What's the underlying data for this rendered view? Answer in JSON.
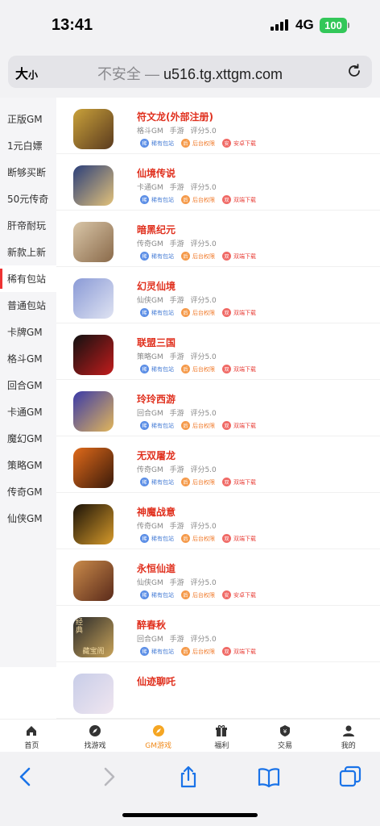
{
  "status": {
    "time": "13:41",
    "network": "4G",
    "battery": "100"
  },
  "browser": {
    "text_size_label": "大",
    "text_size_small": "小",
    "insecure_label": "不安全 —",
    "domain": "u516.tg.xttgm.com"
  },
  "sidebar": {
    "active_index": 6,
    "items": [
      {
        "label": "正版GM"
      },
      {
        "label": "1元白嫖"
      },
      {
        "label": "断够买断"
      },
      {
        "label": "50元传奇"
      },
      {
        "label": "肝帝耐玩"
      },
      {
        "label": "新款上新"
      },
      {
        "label": "稀有包站"
      },
      {
        "label": "普通包站"
      },
      {
        "label": "卡牌GM"
      },
      {
        "label": "格斗GM"
      },
      {
        "label": "回合GM"
      },
      {
        "label": "卡通GM"
      },
      {
        "label": "魔幻GM"
      },
      {
        "label": "策略GM"
      },
      {
        "label": "传奇GM"
      },
      {
        "label": "仙侠GM"
      }
    ]
  },
  "games": [
    {
      "title": "符文龙(外部注册)",
      "meta": "格斗GM 手游 评分5.0",
      "tags": [
        {
          "icon": "稀",
          "label": "稀有包站",
          "color": "blue"
        },
        {
          "icon": "后",
          "label": "后台权限",
          "color": "orange"
        },
        {
          "icon": "安",
          "label": "安卓下载",
          "color": "red"
        }
      ],
      "icon_colors": [
        "#c9a13a",
        "#5a3a1e"
      ]
    },
    {
      "title": "仙境传说",
      "meta": "卡通GM 手游 评分5.0",
      "tags": [
        {
          "icon": "稀",
          "label": "稀有包站",
          "color": "blue"
        },
        {
          "icon": "后",
          "label": "后台权限",
          "color": "orange"
        },
        {
          "icon": "双",
          "label": "双端下载",
          "color": "red"
        }
      ],
      "icon_colors": [
        "#2b3f7a",
        "#e3c27a"
      ]
    },
    {
      "title": "暗黑纪元",
      "meta": "传奇GM 手游 评分5.0",
      "tags": [
        {
          "icon": "稀",
          "label": "稀有包站",
          "color": "blue"
        },
        {
          "icon": "后",
          "label": "后台权限",
          "color": "orange"
        },
        {
          "icon": "双",
          "label": "双端下载",
          "color": "red"
        }
      ],
      "icon_colors": [
        "#d9c6a8",
        "#8a6a4a"
      ]
    },
    {
      "title": "幻灵仙境",
      "meta": "仙侠GM 手游 评分5.0",
      "tags": [
        {
          "icon": "稀",
          "label": "稀有包站",
          "color": "blue"
        },
        {
          "icon": "后",
          "label": "后台权限",
          "color": "orange"
        },
        {
          "icon": "双",
          "label": "双端下载",
          "color": "red"
        }
      ],
      "icon_colors": [
        "#8a9ad6",
        "#dfe3f2"
      ]
    },
    {
      "title": "联盟三国",
      "meta": "策略GM 手游 评分5.0",
      "tags": [
        {
          "icon": "稀",
          "label": "稀有包站",
          "color": "blue"
        },
        {
          "icon": "后",
          "label": "后台权限",
          "color": "orange"
        },
        {
          "icon": "双",
          "label": "双端下载",
          "color": "red"
        }
      ],
      "icon_colors": [
        "#111111",
        "#c21c1c"
      ]
    },
    {
      "title": "玲玲西游",
      "meta": "回合GM 手游 评分5.0",
      "tags": [
        {
          "icon": "稀",
          "label": "稀有包站",
          "color": "blue"
        },
        {
          "icon": "后",
          "label": "后台权限",
          "color": "orange"
        },
        {
          "icon": "双",
          "label": "双端下载",
          "color": "red"
        }
      ],
      "icon_colors": [
        "#3a3aa8",
        "#e2b65a"
      ]
    },
    {
      "title": "无双屠龙",
      "meta": "传奇GM 手游 评分5.0",
      "tags": [
        {
          "icon": "稀",
          "label": "稀有包站",
          "color": "blue"
        },
        {
          "icon": "后",
          "label": "后台权限",
          "color": "orange"
        },
        {
          "icon": "双",
          "label": "双端下载",
          "color": "red"
        }
      ],
      "icon_colors": [
        "#e06a1a",
        "#3a1a0a"
      ]
    },
    {
      "title": "神魔战意",
      "meta": "传奇GM 手游 评分5.0",
      "tags": [
        {
          "icon": "稀",
          "label": "稀有包站",
          "color": "blue"
        },
        {
          "icon": "后",
          "label": "后台权限",
          "color": "orange"
        },
        {
          "icon": "双",
          "label": "双端下载",
          "color": "red"
        }
      ],
      "icon_colors": [
        "#1a1208",
        "#d69a2a"
      ]
    },
    {
      "title": "永恒仙道",
      "meta": "仙侠GM 手游 评分5.0",
      "tags": [
        {
          "icon": "稀",
          "label": "稀有包站",
          "color": "blue"
        },
        {
          "icon": "后",
          "label": "后台权限",
          "color": "orange"
        },
        {
          "icon": "安",
          "label": "安卓下载",
          "color": "red"
        }
      ],
      "icon_colors": [
        "#c98a4a",
        "#5a2a1a"
      ]
    },
    {
      "title": "醉春秋",
      "meta": "回合GM 手游 评分5.0",
      "tags": [
        {
          "icon": "稀",
          "label": "稀有包站",
          "color": "blue"
        },
        {
          "icon": "后",
          "label": "后台权限",
          "color": "orange"
        },
        {
          "icon": "双",
          "label": "双端下载",
          "color": "red"
        }
      ],
      "icon_colors": [
        "#2a2a2a",
        "#c9a45a"
      ],
      "icon_text_top": "经典",
      "icon_text_bottom": "藏宝阁"
    },
    {
      "title": "仙迹聊吒",
      "meta": "",
      "tags": [],
      "icon_colors": [
        "#c8cde8",
        "#f0e6f0"
      ]
    }
  ],
  "tabbar": {
    "active_index": 2,
    "items": [
      {
        "label": "首页",
        "icon": "home-icon"
      },
      {
        "label": "找游戏",
        "icon": "compass-icon"
      },
      {
        "label": "GM游戏",
        "icon": "gm-compass-icon"
      },
      {
        "label": "福利",
        "icon": "gift-icon"
      },
      {
        "label": "交易",
        "icon": "trade-icon"
      },
      {
        "label": "我的",
        "icon": "user-icon"
      }
    ]
  },
  "toolbar": [
    "back-icon",
    "forward-icon",
    "share-icon",
    "bookmarks-icon",
    "tabs-icon"
  ]
}
